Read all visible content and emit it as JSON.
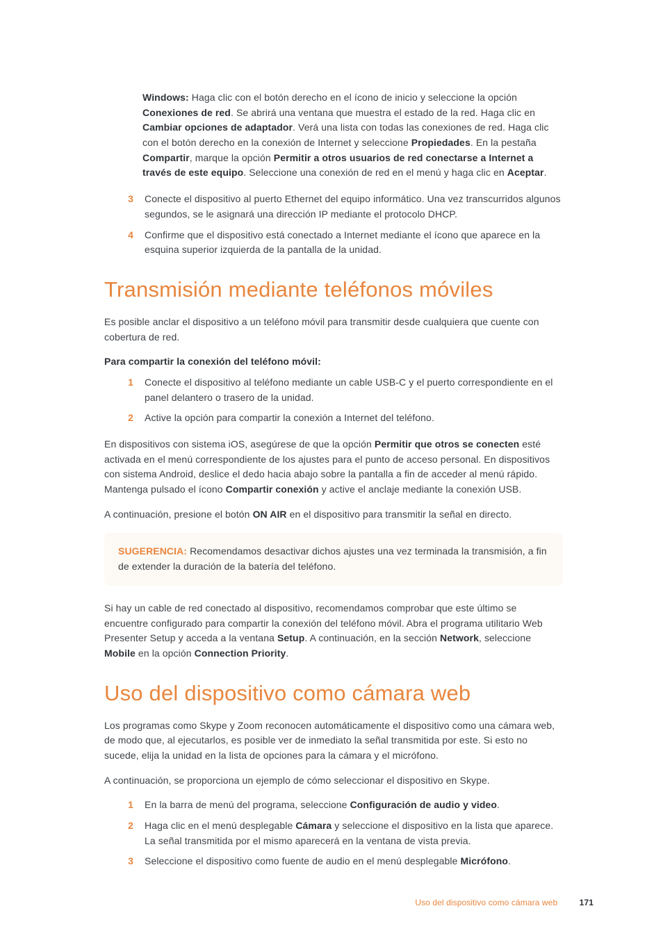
{
  "topIndent": {
    "windows_strong": "Windows:",
    "windows_sentence": " Haga clic con el botón derecho en el ícono de inicio y seleccione la opción ",
    "conexiones": "Conexiones de red",
    "s2": ". Se abrirá una ventana que muestra el estado de la red. Haga clic en ",
    "cambiar": "Cambiar opciones de adaptador",
    "s3": ". Verá una lista con todas las conexiones de red. Haga clic con el botón derecho en la conexión de Internet y seleccione ",
    "propiedades": "Propiedades",
    "s4": ". En la pestaña ",
    "compartir": "Compartir",
    "s5": ", marque la opción ",
    "permitir": "Permitir a otros usuarios de red conectarse a Internet a través de este equipo",
    "s6": ". Seleccione una conexión de red en el menú y haga clic en ",
    "aceptar": "Aceptar",
    "s7": "."
  },
  "listA": [
    {
      "num": "3",
      "text": "Conecte el dispositivo al puerto Ethernet del equipo informático. Una vez transcurridos algunos segundos, se le asignará una dirección IP mediante el protocolo DHCP."
    },
    {
      "num": "4",
      "text": "Confirme que el dispositivo está conectado a Internet mediante el ícono que aparece en la esquina superior izquierda de la pantalla de la unidad."
    }
  ],
  "h1a": "Transmisión mediante teléfonos móviles",
  "p1": "Es posible anclar el dispositivo a un teléfono móvil para transmitir desde cualquiera que cuente con cobertura de red.",
  "sub1": "Para compartir la conexión del teléfono móvil:",
  "listB": [
    {
      "num": "1",
      "text": "Conecte el dispositivo al teléfono mediante un cable USB-C y el puerto correspondiente en el panel delantero o trasero de la unidad."
    },
    {
      "num": "2",
      "text": "Active la opción para compartir la conexión a Internet del teléfono."
    }
  ],
  "p2a": "En dispositivos con sistema iOS, asegúrese de que la opción ",
  "p2b": "Permitir que otros se conecten",
  "p2c": " esté activada en el menú correspondiente de los ajustes para el punto de acceso personal. En dispositivos con sistema Android, deslice el dedo hacia abajo sobre la pantalla a fin de acceder al menú rápido. Mantenga pulsado el ícono ",
  "p2d": "Compartir conexión",
  "p2e": " y active el anclaje mediante la conexión USB.",
  "p3a": "A continuación, presione el botón ",
  "p3b": "ON AIR",
  "p3c": " en el dispositivo para transmitir la señal en directo.",
  "tip_label": "SUGERENCIA:",
  "tip_text": "  Recomendamos desactivar dichos ajustes una vez terminada la transmisión, a fin de extender la duración de la batería del teléfono.",
  "p4a": "Si hay un cable de red conectado al dispositivo, recomendamos comprobar que este último se encuentre configurado para compartir la conexión del teléfono móvil. Abra el programa utilitario Web Presenter Setup y acceda a la ventana ",
  "p4b": "Setup",
  "p4c": ". A continuación, en la sección ",
  "p4d": "Network",
  "p4e": ", seleccione ",
  "p4f": "Mobile",
  "p4g": " en la opción ",
  "p4h": "Connection Priority",
  "p4i": ".",
  "h1b": "Uso del dispositivo como cámara web",
  "p5": "Los programas como Skype y Zoom reconocen automáticamente el dispositivo como una cámara web, de modo que, al ejecutarlos, es posible ver de inmediato la señal transmitida por este. Si esto no sucede, elija la unidad en la lista de opciones para la cámara y el micrófono.",
  "p6": "A continuación, se proporciona un ejemplo de cómo seleccionar el dispositivo en Skype.",
  "listC": [
    {
      "num": "1",
      "text_a": "En la barra de menú del programa, seleccione ",
      "bold": "Configuración de audio y video",
      "text_b": "."
    },
    {
      "num": "2",
      "text_a": "Haga clic en el menú desplegable ",
      "bold": "Cámara",
      "text_b": " y seleccione el dispositivo en la lista que aparece. La señal transmitida por el mismo aparecerá en la ventana de vista previa."
    },
    {
      "num": "3",
      "text_a": "Seleccione el dispositivo como fuente de audio en el menú desplegable ",
      "bold": "Micrófono",
      "text_b": "."
    }
  ],
  "footer_section": "Uso del dispositivo como cámara web",
  "footer_page": "171"
}
